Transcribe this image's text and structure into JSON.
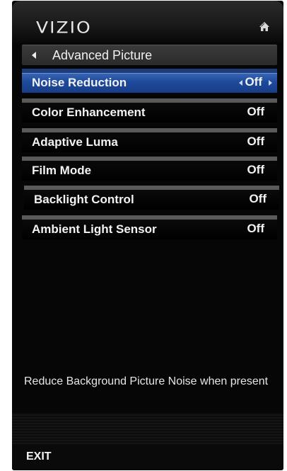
{
  "brand": {
    "logo_text": "VIZIO",
    "home_icon": "home-icon"
  },
  "header": {
    "back_icon": "back-arrow-icon",
    "title": "Advanced Picture"
  },
  "menu": {
    "items": [
      {
        "label": "Noise Reduction",
        "value": "Off",
        "selected": true
      },
      {
        "label": "Color Enhancement",
        "value": "Off",
        "selected": false
      },
      {
        "label": "Adaptive Luma",
        "value": "Off",
        "selected": false
      },
      {
        "label": "Film Mode",
        "value": "Off",
        "selected": false
      },
      {
        "label": "Backlight Control",
        "value": "Off",
        "selected": false
      },
      {
        "label": "Ambient Light Sensor",
        "value": "Off",
        "selected": false
      }
    ]
  },
  "help": {
    "description": "Reduce Background Picture Noise when present"
  },
  "footer": {
    "exit_label": "EXIT"
  },
  "colors": {
    "selected_row": "#2a56a8",
    "panel_bg": "#060606",
    "text": "#f2f2f2"
  }
}
